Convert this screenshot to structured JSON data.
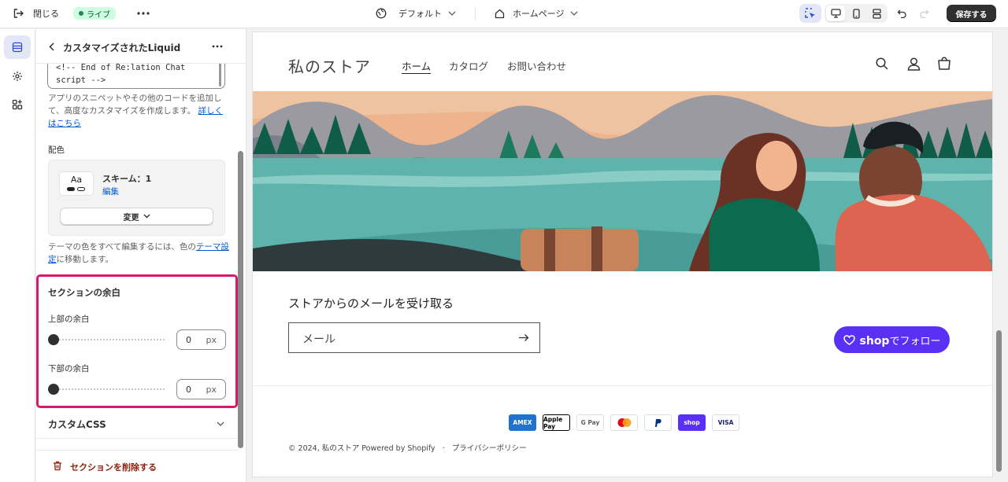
{
  "topbar": {
    "close_label": "閉じる",
    "live_label": "ライブ",
    "theme_label": "デフォルト",
    "page_label": "ホームページ",
    "save_label": "保存する"
  },
  "panel": {
    "title": "カスタマイズされたLiquid",
    "code_lines": [
      "<!-- End of Re:lation Chat",
      "script -->"
    ],
    "help_text": "アプリのスニペットやその他のコードを追加して、高度なカスタマイズを作成します。",
    "help_link": "詳しくはこちら",
    "color_label": "配色",
    "scheme": {
      "swatch_text": "Aa",
      "name": "スキーム：1",
      "edit": "編集",
      "change": "変更"
    },
    "theme_note_pre": "テーマの色をすべて編集するには、色の",
    "theme_note_link": "テーマ設定",
    "theme_note_post": "に移動します。",
    "margin_section": {
      "title": "セクションの余白",
      "top_label": "上部の余白",
      "top_value": "0",
      "bottom_label": "下部の余白",
      "bottom_value": "0",
      "unit": "px",
      "top_slider_fraction": 0,
      "bottom_slider_fraction": 0
    },
    "custom_css": "カスタムCSS",
    "delete_label": "セクションを削除する"
  },
  "preview": {
    "store_name": "私のストア",
    "nav": [
      "ホーム",
      "カタログ",
      "お問い合わせ"
    ],
    "email_title": "ストアからのメールを受け取る",
    "email_placeholder": "メール",
    "shop_word": "shop",
    "follow_label": "でフォロー",
    "payments": [
      "AMEX",
      "Apple Pay",
      "G Pay",
      "Mastercard",
      "PayPal",
      "shop",
      "VISA"
    ],
    "copyright": "© 2024, 私のストア Powered by Shopify",
    "policy": "プライバシーポリシー"
  },
  "colors": {
    "accent_pink": "#d21c6b",
    "shop_purple": "#5a31f4",
    "link_blue": "#005bd3",
    "live_green": "#29845a"
  }
}
